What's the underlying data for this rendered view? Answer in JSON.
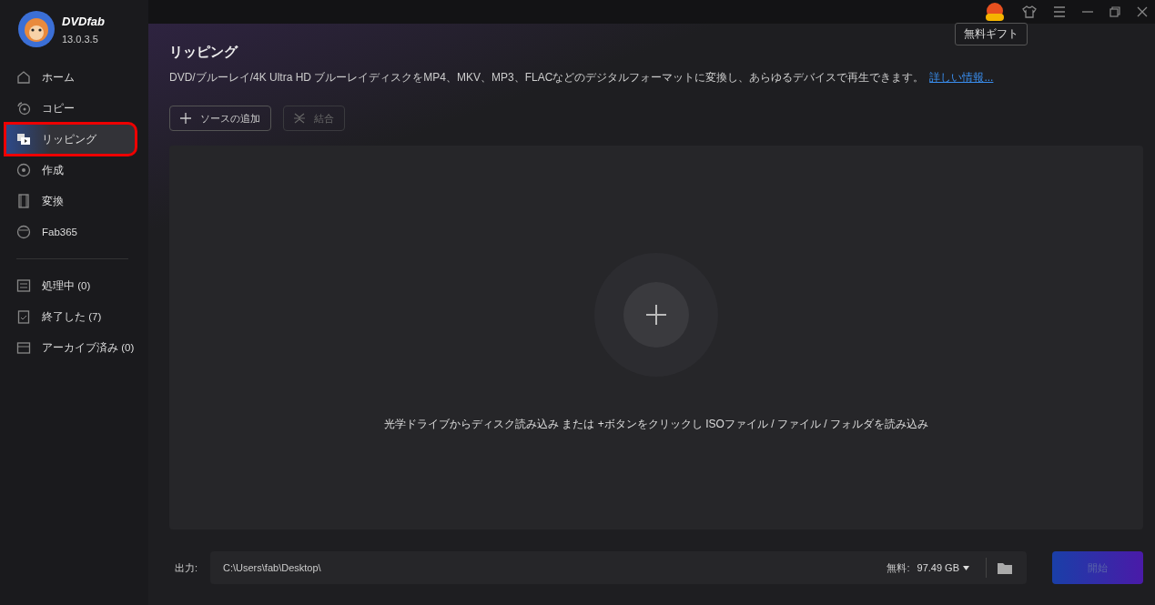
{
  "app": {
    "name": "DVDfab",
    "version": "13.0.3.5"
  },
  "sidebar": {
    "items": [
      {
        "label": "ホーム",
        "selected": false,
        "highlighted": false
      },
      {
        "label": "コピー",
        "selected": false,
        "highlighted": false
      },
      {
        "label": "リッピング",
        "selected": true,
        "highlighted": true
      },
      {
        "label": "作成",
        "selected": false,
        "highlighted": false
      },
      {
        "label": "変換",
        "selected": false,
        "highlighted": false
      },
      {
        "label": "Fab365",
        "selected": false,
        "highlighted": false
      }
    ],
    "queue": [
      {
        "label": "処理中 (0)"
      },
      {
        "label": "終了した (7)"
      },
      {
        "label": "アーカイブ済み (0)"
      }
    ]
  },
  "tooltip": "無料ギフト",
  "page": {
    "title": "リッピング",
    "description": "DVD/ブルーレイ/4K Ultra HD ブルーレイディスクをMP4、MKV、MP3、FLACなどのデジタルフォーマットに変換し、あらゆるデバイスで再生できます。",
    "link": "詳しい情報...",
    "buttons": [
      {
        "label": "ソースの追加",
        "kind": "add",
        "disabled": false
      },
      {
        "label": "結合",
        "kind": "merge",
        "disabled": true
      }
    ],
    "drop_hint": "光学ドライブからディスク読み込み または +ボタンをクリックし ISOファイル / ファイル / フォルダを読み込み"
  },
  "output": {
    "label": "出力:",
    "path": "C:\\Users\\fab\\Desktop\\",
    "free_label": "無料:",
    "free_value": "97.49 GB",
    "start": "開始",
    "start_disabled": true
  }
}
